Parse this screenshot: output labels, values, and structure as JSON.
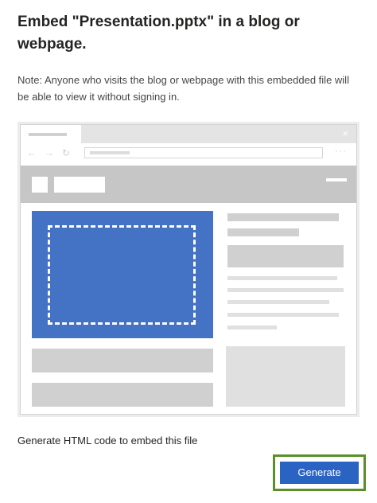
{
  "dialog": {
    "title": "Embed \"Presentation.pptx\" in a blog or webpage.",
    "note": "Note: Anyone who visits the blog or webpage with this embedded file will be able to view it without signing in.",
    "instruction": "Generate HTML code to embed this file",
    "generate_label": "Generate"
  },
  "illustration": {
    "tab_close_glyph": "×",
    "nav_icons": [
      "←",
      "→",
      "↻"
    ],
    "more_glyph": "···",
    "embed_color": "#4472c4"
  },
  "colors": {
    "accent": "#2b63c2",
    "focus_outline": "#5b8f2c"
  }
}
